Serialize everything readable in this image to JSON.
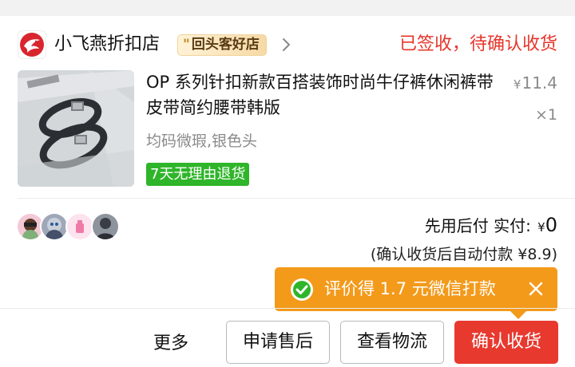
{
  "shop": {
    "name": "小飞燕折扣店",
    "badge": "回头客好店",
    "badge_prefix": "\"",
    "logo_icon": "swallow-logo-icon"
  },
  "order": {
    "status": "已签收，待确认收货"
  },
  "product": {
    "title": "OP 系列针扣新款百搭装饰时尚牛仔裤休闲裤带皮带简约腰带韩版",
    "price_symbol": "¥",
    "price": "11.4",
    "quantity": "×1",
    "sku": "均码微瑕,银色头",
    "return_policy": "7天无理由退货"
  },
  "payment": {
    "label": "先用后付 实付: ",
    "symbol": "¥",
    "amount": "0",
    "auto_pay_note": "(确认收货后自动付款 ¥8.9)"
  },
  "promo": {
    "text": "评价得 1.7 元微信打款",
    "icon": "wechat-icon",
    "close_icon": "close-icon"
  },
  "actions": {
    "more": "更多",
    "after_sale": "申请售后",
    "logistics": "查看物流",
    "confirm": "确认收货"
  },
  "colors": {
    "accent_red": "#e6352b",
    "green_badge": "#2fb52a",
    "tooltip_orange": "#f39a1b",
    "price_gray": "#8a8a8a"
  }
}
